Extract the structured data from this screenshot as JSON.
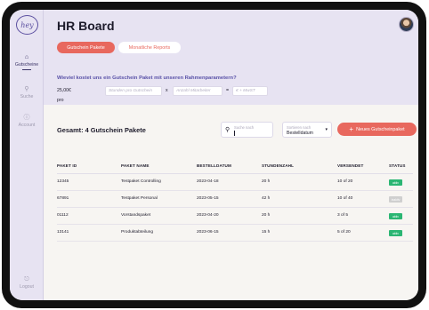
{
  "sidebar": {
    "logo_text": "hey",
    "items": [
      {
        "label": "Gutscheine",
        "icon": "home-icon",
        "glyph": "⌂",
        "active": true
      },
      {
        "label": "Suche",
        "icon": "search-icon",
        "glyph": "⚲",
        "active": false
      },
      {
        "label": "Account",
        "icon": "account-icon",
        "glyph": "ⓘ",
        "active": false
      }
    ],
    "logout": {
      "label": "Logout",
      "icon": "logout-icon",
      "glyph": "⎋"
    }
  },
  "header": {
    "title": "HR Board",
    "avatar_icon": "user-avatar",
    "tabs": [
      {
        "label": "Gutschein Pakete",
        "active": true
      },
      {
        "label": "Monatliche Reports",
        "active": false
      }
    ],
    "question": "Wieviel kostet uns ein Gutschein Paket mit unseren Rahmenparametern?",
    "calc": {
      "price_label": "25,00€ pro Stunde x",
      "hours_placeholder": "Stunden pro Gutschein",
      "times": "x",
      "employees_placeholder": "Anzahl Mitarbeiter",
      "equals": "=",
      "result_placeholder": "€ + MwST"
    }
  },
  "content": {
    "title": "Gesamt: 4 Gutschein Pakete",
    "search": {
      "label": "Suche nach",
      "icon": "search-icon"
    },
    "sort": {
      "label": "Sortieren nach",
      "value": "Bestelldatum",
      "icon": "chevron-down-icon"
    },
    "add_button": {
      "label": "Neues Gutscheinpaket",
      "icon": "plus-icon"
    },
    "columns": [
      "PAKET ID",
      "PAKET NAME",
      "BESTELLDATUM",
      "STUNDENZAHL",
      "VERSENDET",
      "STATUS"
    ],
    "rows": [
      {
        "id": "12345",
        "name": "Testpaket Controlling",
        "date": "2023-04-18",
        "hours": "20 h",
        "sent": "10 of 20",
        "status": "aktiv",
        "status_color": "#2bb673"
      },
      {
        "id": "67891",
        "name": "Testpaket Personal",
        "date": "2023-05-15",
        "hours": "42 h",
        "sent": "10 of 40",
        "status": "inaktiv",
        "status_color": "#cfcfcf"
      },
      {
        "id": "01112",
        "name": "Vorstandspaket",
        "date": "2023-04-20",
        "hours": "20 h",
        "sent": "3 of 5",
        "status": "aktiv",
        "status_color": "#2bb673"
      },
      {
        "id": "13141",
        "name": "Produktabteilung",
        "date": "2023-06-15",
        "hours": "15 h",
        "sent": "5 of 20",
        "status": "aktiv",
        "status_color": "#2bb673"
      }
    ]
  },
  "colors": {
    "accent": "#e8685e",
    "brand": "#5a52a8",
    "header_bg": "#e7e3f2",
    "success": "#2bb673"
  }
}
